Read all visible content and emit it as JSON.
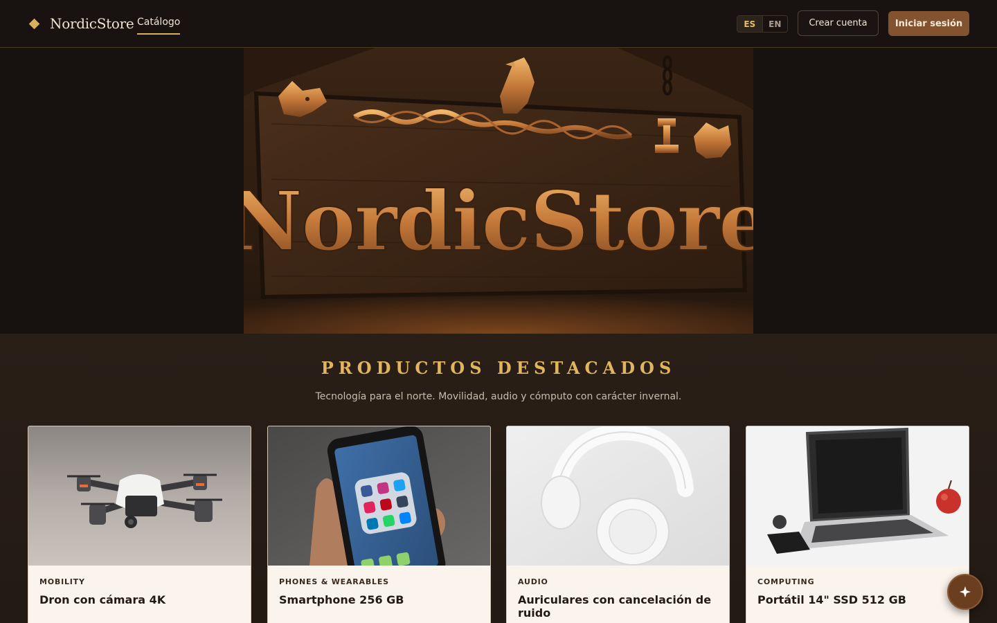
{
  "header": {
    "brand": "NordicStore",
    "nav": {
      "catalog": "Catálogo"
    },
    "languages": [
      "ES",
      "EN"
    ],
    "active_language": "ES",
    "create_account": "Crear cuenta",
    "sign_in": "Iniciar sesión"
  },
  "hero": {
    "sign_text": "NordicStore",
    "icons": [
      "wolf-head-icon",
      "raven-icon",
      "hammer-icon"
    ]
  },
  "featured": {
    "title": "PRODUCTOS DESTACADOS",
    "subtitle": "Tecnología para el norte. Movilidad, audio y cómputo con carácter invernal.",
    "products": [
      {
        "category": "MOBILITY",
        "name": "Dron con cámara 4K",
        "image": "drone-image"
      },
      {
        "category": "PHONES & WEARABLES",
        "name": "Smartphone 256 GB",
        "image": "smartphone-image"
      },
      {
        "category": "AUDIO",
        "name": "Auriculares con cancelación de ruido",
        "image": "headphones-image"
      },
      {
        "category": "COMPUTING",
        "name": "Portátil 14\" SSD 512 GB",
        "image": "laptop-image"
      }
    ]
  },
  "fab": {
    "icon": "sparkle-icon"
  },
  "colors": {
    "accent": "#d9b15c",
    "primary_button": "#83532f",
    "background": "#1a1512",
    "card": "#fbf4ed"
  }
}
